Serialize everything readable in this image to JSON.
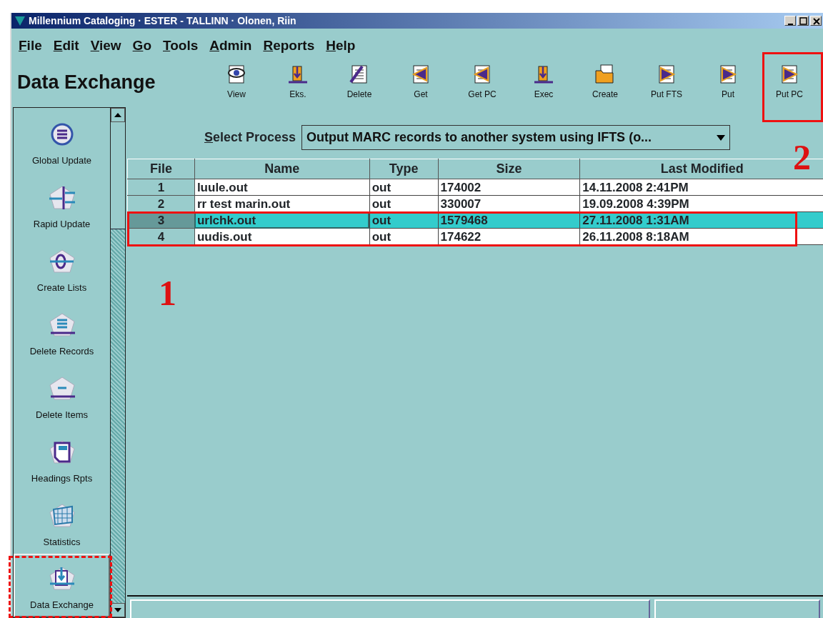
{
  "window": {
    "title": "Millennium Cataloging · ESTER - TALLINN · Olonen, Riin"
  },
  "menu": [
    {
      "label": "File"
    },
    {
      "label": "Edit"
    },
    {
      "label": "View"
    },
    {
      "label": "Go"
    },
    {
      "label": "Tools"
    },
    {
      "label": "Admin"
    },
    {
      "label": "Reports"
    },
    {
      "label": "Help"
    }
  ],
  "page_title": "Data Exchange",
  "toolbar": [
    {
      "label": "View",
      "kind": "eye"
    },
    {
      "label": "Eks.",
      "kind": "download"
    },
    {
      "label": "Delete",
      "kind": "delete"
    },
    {
      "label": "Get",
      "kind": "get"
    },
    {
      "label": "Get PC",
      "kind": "get"
    },
    {
      "label": "Exec",
      "kind": "download"
    },
    {
      "label": "Create",
      "kind": "folder"
    },
    {
      "label": "Put FTS",
      "kind": "put"
    },
    {
      "label": "Put",
      "kind": "put"
    },
    {
      "label": "Put PC",
      "kind": "put"
    }
  ],
  "sidebar": {
    "items": [
      {
        "label": "Global Update",
        "kind": "cycle",
        "selected": false
      },
      {
        "label": "Rapid Update",
        "kind": "split",
        "selected": false
      },
      {
        "label": "Create Lists",
        "kind": "ring",
        "selected": false
      },
      {
        "label": "Delete Records",
        "kind": "lines",
        "selected": false
      },
      {
        "label": "Delete Items",
        "kind": "dash",
        "selected": false
      },
      {
        "label": "Headings Rpts",
        "kind": "page",
        "selected": false
      },
      {
        "label": "Statistics",
        "kind": "grid",
        "selected": false
      },
      {
        "label": "Data Exchange",
        "kind": "exchange",
        "selected": true
      }
    ]
  },
  "select_process": {
    "label": "Select Process",
    "value": "Output MARC records to another system using IFTS (o..."
  },
  "table": {
    "columns": [
      "File",
      "Name",
      "Type",
      "Size",
      "Last Modified"
    ],
    "rows": [
      {
        "cells": [
          "1",
          "luule.out",
          "out",
          "174002",
          "14.11.2008 2:41PM"
        ],
        "selected": false
      },
      {
        "cells": [
          "2",
          "rr test marin.out",
          "out",
          "330007",
          "19.09.2008 4:39PM"
        ],
        "selected": false
      },
      {
        "cells": [
          "3",
          "urlchk.out",
          "out",
          "1579468",
          "27.11.2008 1:31AM"
        ],
        "selected": true
      },
      {
        "cells": [
          "4",
          "uudis.out",
          "out",
          "174622",
          "26.11.2008 8:18AM"
        ],
        "selected": false
      }
    ]
  },
  "annotations": [
    {
      "kind": "frame"
    },
    {
      "kind": "frame"
    },
    {
      "kind": "dashed-frame"
    },
    {
      "kind": "number",
      "label": "1"
    },
    {
      "kind": "number",
      "label": "2"
    }
  ]
}
